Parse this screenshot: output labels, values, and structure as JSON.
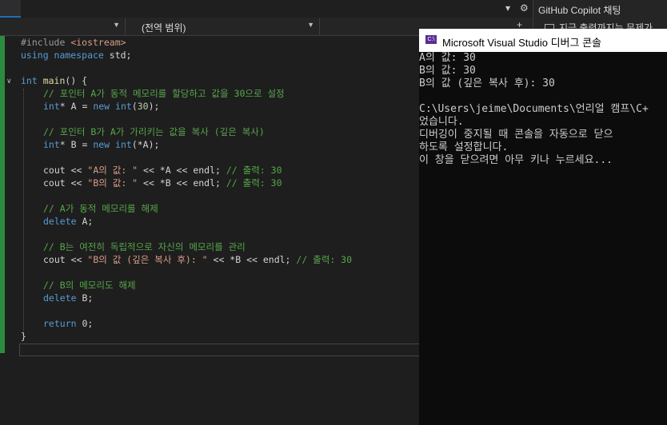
{
  "navbar": {
    "scope_label": "(전역 범위)"
  },
  "copilot": {
    "title": "GitHub Copilot 채팅",
    "row": "지금 출력까지는 문제가"
  },
  "console": {
    "title": "Microsoft Visual Studio 디버그 콘솔",
    "icon_text": "C:\\",
    "lines": [
      "A의 값: 30",
      "B의 값: 30",
      "B의 값 (깊은 복사 후): 30",
      "",
      "C:\\Users\\jeime\\Documents\\언리얼 캠프\\C+",
      "었습니다.",
      "디버깅이 중지될 때 콘솔을 자동으로 닫으",
      "하도록 설정합니다.",
      "이 창을 닫으려면 아무 키나 누르세요..."
    ]
  },
  "code": {
    "l1a": "#include ",
    "l1b": "<iostream>",
    "l2a": "using namespace",
    "l2b": " std;",
    "l4a": "int",
    "l4b": " main",
    "l4c": "() {",
    "l5": "// 포인터 A가 동적 메모리를 할당하고 값을 30으로 설정",
    "l6a": "int",
    "l6b": "* A = ",
    "l6c": "new",
    "l6d": " int",
    "l6e": "(",
    "l6f": "30",
    "l6g": ");",
    "l8": "// 포인터 B가 A가 가리키는 값을 복사 (깊은 복사)",
    "l9a": "int",
    "l9b": "* B = ",
    "l9c": "new",
    "l9d": " int",
    "l9e": "(*A);",
    "l11a": "cout << ",
    "l11b": "\"A의 값: \"",
    "l11c": " << *A << endl; ",
    "l11d": "// 출력: 30",
    "l12a": "cout << ",
    "l12b": "\"B의 값: \"",
    "l12c": " << *B << endl; ",
    "l12d": "// 출력: 30",
    "l14": "// A가 동적 메모리를 해제",
    "l15a": "delete",
    "l15b": " A;",
    "l17": "// B는 여전히 독립적으로 자신의 메모리를 관리",
    "l18a": "cout << ",
    "l18b": "\"B의 값 (깊은 복사 후): \"",
    "l18c": " << *B << endl; ",
    "l18d": "// 출력: 30",
    "l20": "// B의 메모리도 해제",
    "l21a": "delete",
    "l21b": " B;",
    "l23a": "return",
    "l23b": " 0;",
    "l24": "}"
  }
}
